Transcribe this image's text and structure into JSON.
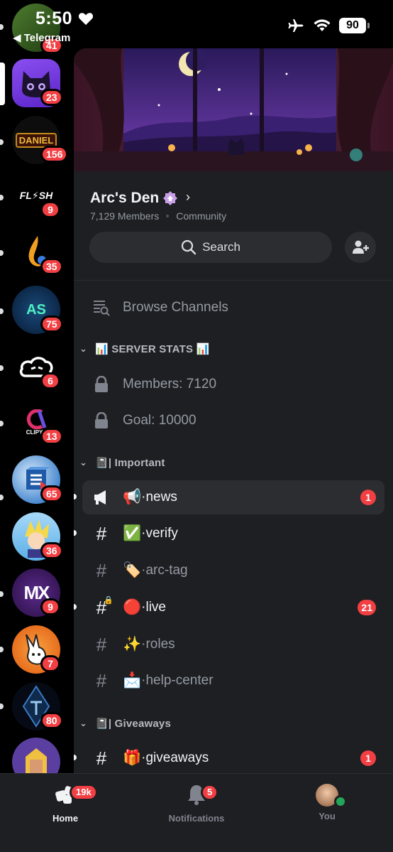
{
  "status_bar": {
    "time": "5:50",
    "back_app": "◀ Telegram",
    "battery": "90"
  },
  "rail": {
    "servers": [
      {
        "badge": "41",
        "bg": "#3b6b2a"
      },
      {
        "badge": "23",
        "bg": "#7b3fe4"
      },
      {
        "badge": "156",
        "bg": "#111111"
      },
      {
        "badge": "9",
        "bg": "#000000"
      },
      {
        "badge": "35",
        "bg": "#000000"
      },
      {
        "badge": "75",
        "bg": "#0b2a4a"
      },
      {
        "badge": "6",
        "bg": "#000000"
      },
      {
        "badge": "13",
        "bg": "#000000"
      },
      {
        "badge": "65",
        "bg": "#2e6fb8"
      },
      {
        "badge": "36",
        "bg": "#7fc4f0"
      },
      {
        "badge": "9",
        "bg": "#3a1a5c"
      },
      {
        "badge": "7",
        "bg": "#f07a2a"
      },
      {
        "badge": "80",
        "bg": "#0b1a2e"
      },
      {
        "badge": "",
        "bg": "#5b3fa0"
      }
    ],
    "server_text": {
      "daniel": "DANIEL",
      "flash": "FL⚡SH",
      "as": "AS",
      "clip": "CLIPYL",
      "mx": "MX"
    }
  },
  "server": {
    "name": "Arc's Den",
    "members": "7,129 Members",
    "type": "Community",
    "search_label": "Search"
  },
  "channels": {
    "browse": "Browse Channels",
    "categories": {
      "stats": "📊 SERVER STATS 📊",
      "important": "📓| Important",
      "giveaways": "📓| Giveaways"
    },
    "items": [
      {
        "emoji": "",
        "label": "Members: 7120"
      },
      {
        "emoji": "",
        "label": "Goal: 10000"
      },
      {
        "emoji": "📢",
        "label": "·news",
        "count": "1"
      },
      {
        "emoji": "✅",
        "label": "·verify"
      },
      {
        "emoji": "🏷️",
        "label": "·arc-tag"
      },
      {
        "emoji": "🔴",
        "label": "·live",
        "count": "21"
      },
      {
        "emoji": "✨",
        "label": "·roles"
      },
      {
        "emoji": "📩",
        "label": "·help-center"
      },
      {
        "emoji": "🎁",
        "label": "·giveaways",
        "count": "1"
      }
    ]
  },
  "bottom_nav": {
    "home": {
      "label": "Home",
      "badge": "19k"
    },
    "notifications": {
      "label": "Notifications",
      "badge": "5"
    },
    "you": {
      "label": "You"
    }
  },
  "colors": {
    "accent_red": "#f23f43",
    "panel_bg": "#1e1f22",
    "online_green": "#23a55a"
  }
}
